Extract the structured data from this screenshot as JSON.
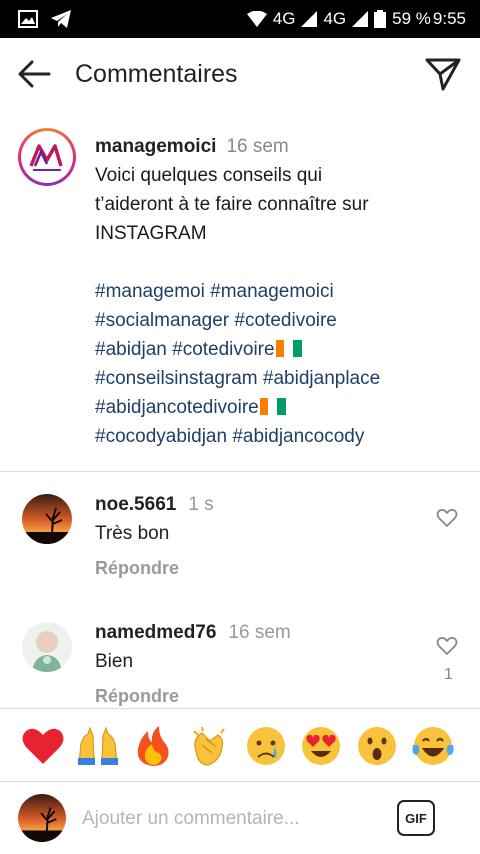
{
  "status_bar": {
    "network1": "4G",
    "network2": "4G",
    "battery": "59 %",
    "time": "9:55"
  },
  "header": {
    "title": "Commentaires",
    "back_icon": "arrow-left-icon",
    "share_icon": "paper-plane-icon"
  },
  "caption": {
    "username": "managemoici",
    "time": "16 sem",
    "text_line1": "Voici quelques conseils qui",
    "text_line2": "t’aideront à te faire connaître sur",
    "text_line3": "INSTAGRAM",
    "hashtags": {
      "h1": "#managemoi",
      "h2": "#managemoici",
      "h3": "#socialmanager",
      "h4": "#cotedivoire",
      "h5": "#abidjan",
      "h6": "#cotedivoire",
      "h7": "#conseilsinstagram",
      "h8": "#abidjanplace",
      "h9": "#abidjancotedivoire",
      "h10": "#cocodyabidjan",
      "h11": "#abidjancocody"
    },
    "flag_colors": [
      "#f77f00",
      "#ffffff",
      "#009e60"
    ]
  },
  "comments": [
    {
      "username": "noe.5661",
      "time": "1 s",
      "text": "Très bon",
      "reply": "Répondre",
      "likes": ""
    },
    {
      "username": "namedmed76",
      "time": "16 sem",
      "text": "Bien",
      "reply": "Répondre",
      "likes": "1"
    }
  ],
  "emoji_bar": [
    "red-heart",
    "raising-hands",
    "fire",
    "clapping-hands",
    "crying-face",
    "heart-eyes-face",
    "surprised-face",
    "tears-of-joy-face"
  ],
  "input": {
    "placeholder": "Ajouter un commentaire...",
    "gif_label": "GIF"
  },
  "colors": {
    "hashtag": "#1f3f66",
    "muted": "#999999",
    "divider": "#dcdcdc"
  }
}
